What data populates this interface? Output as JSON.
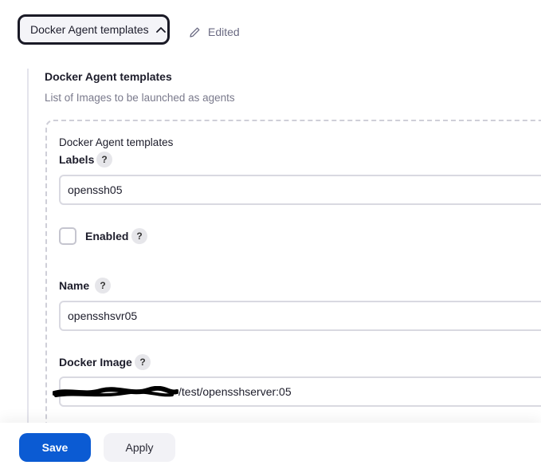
{
  "toggle": {
    "label": "Docker Agent templates",
    "icon": "chevron-up-icon"
  },
  "status": {
    "label": "Edited",
    "icon": "pencil-icon"
  },
  "section": {
    "title": "Docker Agent templates",
    "description": "List of Images to be launched as agents"
  },
  "template": {
    "header": "Docker Agent templates",
    "labels": {
      "label": "Labels",
      "help": "?",
      "value": "openssh05"
    },
    "enabled": {
      "label": "Enabled",
      "help": "?",
      "checked": false
    },
    "name": {
      "label": "Name",
      "help": "?",
      "value": "opensshsvr05"
    },
    "docker_image": {
      "label": "Docker Image",
      "help": "?",
      "value": "/test/opensshserver:05"
    }
  },
  "actions": {
    "save_label": "Save",
    "apply_label": "Apply"
  },
  "colors": {
    "primary": "#0b5bd3",
    "border": "#d9d9e1"
  }
}
